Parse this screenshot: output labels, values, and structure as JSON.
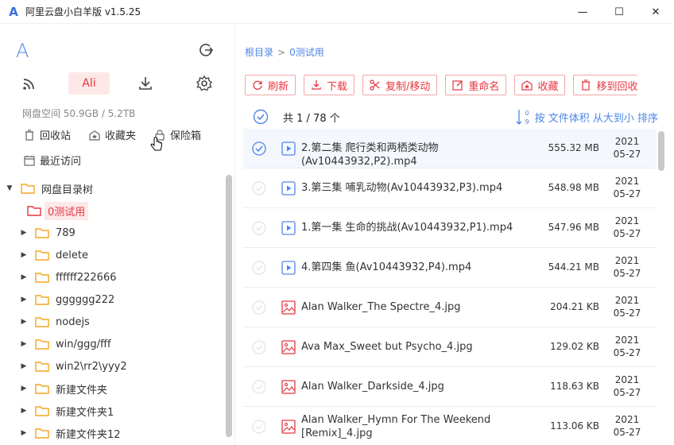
{
  "window": {
    "title": "阿里云盘小白羊版 v1.5.25",
    "icon_letter": "A",
    "minimize": "—",
    "maximize": "☐",
    "close": "✕"
  },
  "sidebar": {
    "logo": "A",
    "ali_label": "Ali",
    "space_text": "网盘空间 50.9GB / 5.2TB",
    "quick": {
      "recycle": "回收站",
      "favorites": "收藏夹",
      "safebox": "保险箱",
      "recent": "最近访问"
    },
    "tree": {
      "root": "网盘目录树",
      "children": [
        "0测试用",
        "789",
        "delete",
        "ffffff222666",
        "gggggg222",
        "nodejs",
        "win/ggg/fff",
        "win2\\rr2\\yyy2",
        "新建文件夹",
        "新建文件夹1",
        "新建文件夹12"
      ]
    }
  },
  "breadcrumb": {
    "root": "根目录",
    "sep": ">",
    "current": "0测试用"
  },
  "toolbar": {
    "refresh": "刷新",
    "download": "下载",
    "copy_move": "复制/移动",
    "rename": "重命名",
    "favorite": "收藏",
    "trash": "移到回收"
  },
  "list": {
    "count": "共 1 / 78 个",
    "sort": "按 文件体积 从大到小 排序",
    "sort_icon_top": "0",
    "sort_icon_bottom": "9",
    "rows": [
      {
        "name": "2.第二集 爬行类和两栖类动物(Av10443932,P2).mp4",
        "size": "555.32 MB",
        "year": "2021",
        "date": "05-27",
        "type": "video",
        "selected": true
      },
      {
        "name": "3.第三集 哺乳动物(Av10443932,P3).mp4",
        "size": "548.98 MB",
        "year": "2021",
        "date": "05-27",
        "type": "video",
        "selected": false
      },
      {
        "name": "1.第一集 生命的挑战(Av10443932,P1).mp4",
        "size": "547.96 MB",
        "year": "2021",
        "date": "05-27",
        "type": "video",
        "selected": false
      },
      {
        "name": "4.第四集 鱼(Av10443932,P4).mp4",
        "size": "544.21 MB",
        "year": "2021",
        "date": "05-27",
        "type": "video",
        "selected": false
      },
      {
        "name": "Alan Walker_The Spectre_4.jpg",
        "size": "204.21 KB",
        "year": "2021",
        "date": "05-27",
        "type": "image",
        "selected": false
      },
      {
        "name": "Ava Max_Sweet but Psycho_4.jpg",
        "size": "129.02 KB",
        "year": "2021",
        "date": "05-27",
        "type": "image",
        "selected": false
      },
      {
        "name": "Alan Walker_Darkside_4.jpg",
        "size": "118.63 KB",
        "year": "2021",
        "date": "05-27",
        "type": "image",
        "selected": false
      },
      {
        "name": "Alan Walker_Hymn For The Weekend [Remix]_4.jpg",
        "size": "113.06 KB",
        "year": "2021",
        "date": "05-27",
        "type": "image",
        "selected": false
      }
    ]
  },
  "colors": {
    "accent_red": "#e6363f",
    "accent_blue": "#4f86e8",
    "folder": "#f5a623"
  }
}
